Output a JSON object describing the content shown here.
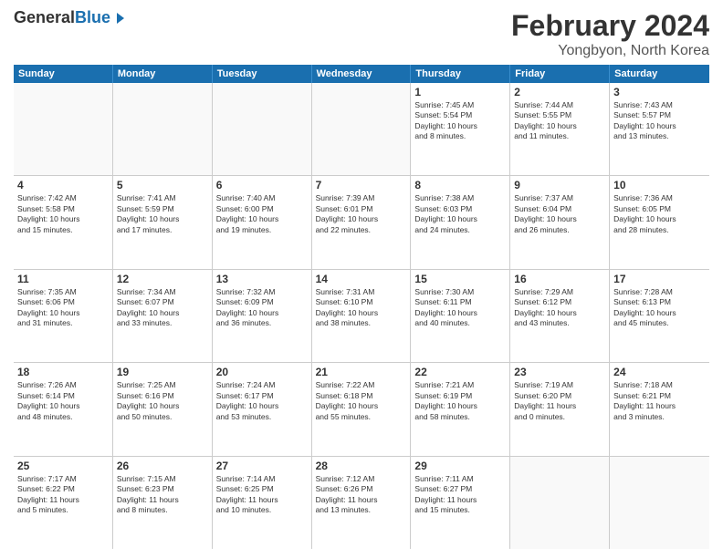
{
  "header": {
    "logo_general": "General",
    "logo_blue": "Blue",
    "main_title": "February 2024",
    "sub_title": "Yongbyon, North Korea"
  },
  "weekdays": [
    "Sunday",
    "Monday",
    "Tuesday",
    "Wednesday",
    "Thursday",
    "Friday",
    "Saturday"
  ],
  "rows": [
    [
      {
        "day": "",
        "empty": true
      },
      {
        "day": "",
        "empty": true
      },
      {
        "day": "",
        "empty": true
      },
      {
        "day": "",
        "empty": true
      },
      {
        "day": "1",
        "lines": [
          "Sunrise: 7:45 AM",
          "Sunset: 5:54 PM",
          "Daylight: 10 hours",
          "and 8 minutes."
        ]
      },
      {
        "day": "2",
        "lines": [
          "Sunrise: 7:44 AM",
          "Sunset: 5:55 PM",
          "Daylight: 10 hours",
          "and 11 minutes."
        ]
      },
      {
        "day": "3",
        "lines": [
          "Sunrise: 7:43 AM",
          "Sunset: 5:57 PM",
          "Daylight: 10 hours",
          "and 13 minutes."
        ]
      }
    ],
    [
      {
        "day": "4",
        "lines": [
          "Sunrise: 7:42 AM",
          "Sunset: 5:58 PM",
          "Daylight: 10 hours",
          "and 15 minutes."
        ]
      },
      {
        "day": "5",
        "lines": [
          "Sunrise: 7:41 AM",
          "Sunset: 5:59 PM",
          "Daylight: 10 hours",
          "and 17 minutes."
        ]
      },
      {
        "day": "6",
        "lines": [
          "Sunrise: 7:40 AM",
          "Sunset: 6:00 PM",
          "Daylight: 10 hours",
          "and 19 minutes."
        ]
      },
      {
        "day": "7",
        "lines": [
          "Sunrise: 7:39 AM",
          "Sunset: 6:01 PM",
          "Daylight: 10 hours",
          "and 22 minutes."
        ]
      },
      {
        "day": "8",
        "lines": [
          "Sunrise: 7:38 AM",
          "Sunset: 6:03 PM",
          "Daylight: 10 hours",
          "and 24 minutes."
        ]
      },
      {
        "day": "9",
        "lines": [
          "Sunrise: 7:37 AM",
          "Sunset: 6:04 PM",
          "Daylight: 10 hours",
          "and 26 minutes."
        ]
      },
      {
        "day": "10",
        "lines": [
          "Sunrise: 7:36 AM",
          "Sunset: 6:05 PM",
          "Daylight: 10 hours",
          "and 28 minutes."
        ]
      }
    ],
    [
      {
        "day": "11",
        "lines": [
          "Sunrise: 7:35 AM",
          "Sunset: 6:06 PM",
          "Daylight: 10 hours",
          "and 31 minutes."
        ]
      },
      {
        "day": "12",
        "lines": [
          "Sunrise: 7:34 AM",
          "Sunset: 6:07 PM",
          "Daylight: 10 hours",
          "and 33 minutes."
        ]
      },
      {
        "day": "13",
        "lines": [
          "Sunrise: 7:32 AM",
          "Sunset: 6:09 PM",
          "Daylight: 10 hours",
          "and 36 minutes."
        ]
      },
      {
        "day": "14",
        "lines": [
          "Sunrise: 7:31 AM",
          "Sunset: 6:10 PM",
          "Daylight: 10 hours",
          "and 38 minutes."
        ]
      },
      {
        "day": "15",
        "lines": [
          "Sunrise: 7:30 AM",
          "Sunset: 6:11 PM",
          "Daylight: 10 hours",
          "and 40 minutes."
        ]
      },
      {
        "day": "16",
        "lines": [
          "Sunrise: 7:29 AM",
          "Sunset: 6:12 PM",
          "Daylight: 10 hours",
          "and 43 minutes."
        ]
      },
      {
        "day": "17",
        "lines": [
          "Sunrise: 7:28 AM",
          "Sunset: 6:13 PM",
          "Daylight: 10 hours",
          "and 45 minutes."
        ]
      }
    ],
    [
      {
        "day": "18",
        "lines": [
          "Sunrise: 7:26 AM",
          "Sunset: 6:14 PM",
          "Daylight: 10 hours",
          "and 48 minutes."
        ]
      },
      {
        "day": "19",
        "lines": [
          "Sunrise: 7:25 AM",
          "Sunset: 6:16 PM",
          "Daylight: 10 hours",
          "and 50 minutes."
        ]
      },
      {
        "day": "20",
        "lines": [
          "Sunrise: 7:24 AM",
          "Sunset: 6:17 PM",
          "Daylight: 10 hours",
          "and 53 minutes."
        ]
      },
      {
        "day": "21",
        "lines": [
          "Sunrise: 7:22 AM",
          "Sunset: 6:18 PM",
          "Daylight: 10 hours",
          "and 55 minutes."
        ]
      },
      {
        "day": "22",
        "lines": [
          "Sunrise: 7:21 AM",
          "Sunset: 6:19 PM",
          "Daylight: 10 hours",
          "and 58 minutes."
        ]
      },
      {
        "day": "23",
        "lines": [
          "Sunrise: 7:19 AM",
          "Sunset: 6:20 PM",
          "Daylight: 11 hours",
          "and 0 minutes."
        ]
      },
      {
        "day": "24",
        "lines": [
          "Sunrise: 7:18 AM",
          "Sunset: 6:21 PM",
          "Daylight: 11 hours",
          "and 3 minutes."
        ]
      }
    ],
    [
      {
        "day": "25",
        "lines": [
          "Sunrise: 7:17 AM",
          "Sunset: 6:22 PM",
          "Daylight: 11 hours",
          "and 5 minutes."
        ]
      },
      {
        "day": "26",
        "lines": [
          "Sunrise: 7:15 AM",
          "Sunset: 6:23 PM",
          "Daylight: 11 hours",
          "and 8 minutes."
        ]
      },
      {
        "day": "27",
        "lines": [
          "Sunrise: 7:14 AM",
          "Sunset: 6:25 PM",
          "Daylight: 11 hours",
          "and 10 minutes."
        ]
      },
      {
        "day": "28",
        "lines": [
          "Sunrise: 7:12 AM",
          "Sunset: 6:26 PM",
          "Daylight: 11 hours",
          "and 13 minutes."
        ]
      },
      {
        "day": "29",
        "lines": [
          "Sunrise: 7:11 AM",
          "Sunset: 6:27 PM",
          "Daylight: 11 hours",
          "and 15 minutes."
        ]
      },
      {
        "day": "",
        "empty": true
      },
      {
        "day": "",
        "empty": true
      }
    ]
  ]
}
